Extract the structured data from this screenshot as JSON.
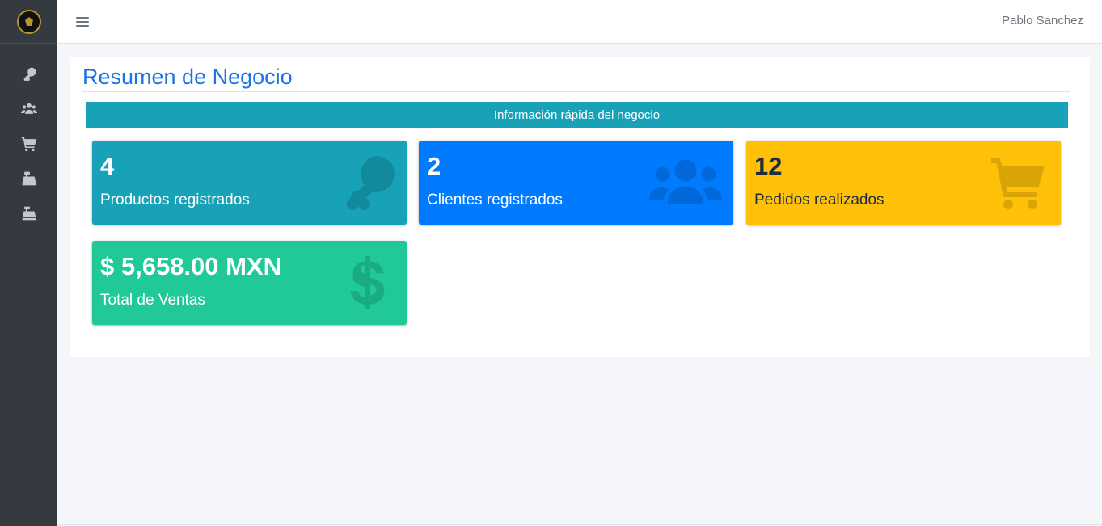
{
  "navbar": {
    "user_name": "Pablo Sanchez"
  },
  "sidebar": {
    "items": [
      {
        "icon": "drumstick-icon"
      },
      {
        "icon": "users-icon"
      },
      {
        "icon": "cart-icon"
      },
      {
        "icon": "cash-register-icon"
      },
      {
        "icon": "cash-register-icon"
      }
    ]
  },
  "main": {
    "title": "Resumen de Negocio",
    "info_bar": "Información rápida del negocio",
    "boxes": [
      {
        "value": "4",
        "label": "Productos registrados",
        "icon": "drumstick-icon",
        "color": "#17a2b8"
      },
      {
        "value": "2",
        "label": "Clientes registrados",
        "icon": "users-icon",
        "color": "#007bff"
      },
      {
        "value": "12",
        "label": "Pedidos realizados",
        "icon": "cart-icon",
        "color": "#ffc107"
      },
      {
        "value": "$ 5,658.00 MXN",
        "label": "Total de Ventas",
        "icon": "dollar-icon",
        "color": "#20c997"
      }
    ]
  }
}
